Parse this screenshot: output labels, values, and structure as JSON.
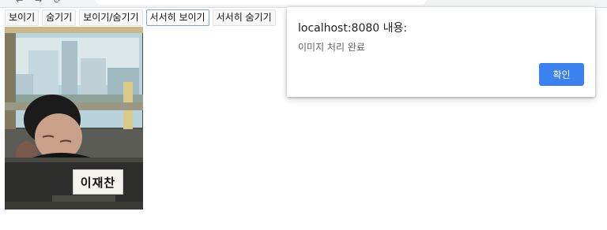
{
  "toolbar": {
    "buttons": [
      "보이기",
      "숨기기",
      "보이기/숨기기",
      "서서히 보이기",
      "서서히 숨기기"
    ]
  },
  "photo": {
    "nameplate": "이재찬"
  },
  "dialog": {
    "title": "localhost:8080 내용:",
    "message": "이미지 처리 완료",
    "ok_label": "확인"
  },
  "colors": {
    "accent": "#3b82f0",
    "focus_border": "#7aa7d8"
  }
}
